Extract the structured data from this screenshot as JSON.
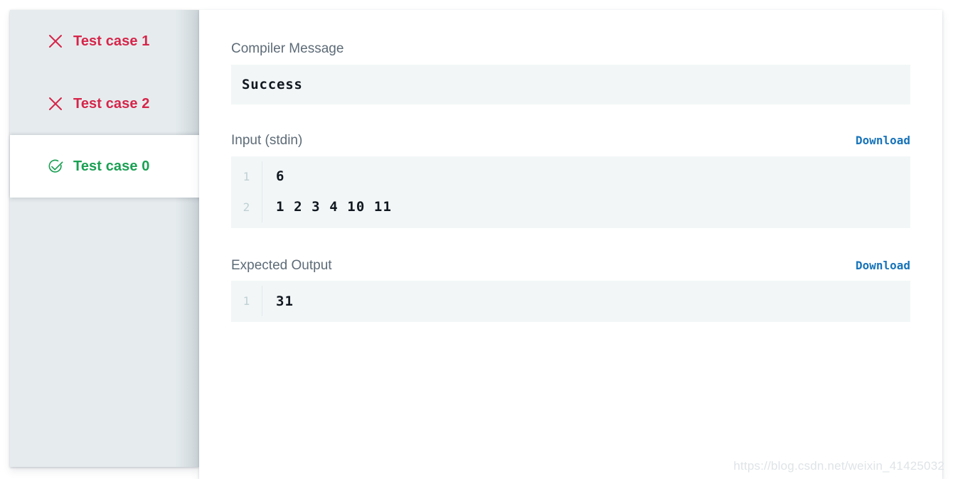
{
  "colors": {
    "fail": "#d6254a",
    "pass": "#1aa053",
    "link": "#1773b9",
    "label": "#5d6b77",
    "sidebar_bg": "#e6ecee",
    "code_bg": "#f2f6f7",
    "gutter_text": "#bfd0d3",
    "code_text": "#10171f"
  },
  "sidebar": {
    "items": [
      {
        "label": "Test case 1",
        "status": "failed",
        "icon": "close-x-icon",
        "active": false
      },
      {
        "label": "Test case 2",
        "status": "failed",
        "icon": "close-x-icon",
        "active": false
      },
      {
        "label": "Test case 0",
        "status": "passed",
        "icon": "check-circle-icon",
        "active": true
      }
    ]
  },
  "main": {
    "compiler": {
      "label": "Compiler Message",
      "message": "Success"
    },
    "input": {
      "label": "Input (stdin)",
      "download_label": "Download",
      "lines": [
        {
          "no": "1",
          "text": "6"
        },
        {
          "no": "2",
          "text": "1 2 3 4 10 11"
        }
      ]
    },
    "expected": {
      "label": "Expected Output",
      "download_label": "Download",
      "lines": [
        {
          "no": "1",
          "text": "31"
        }
      ]
    }
  },
  "watermark": "https://blog.csdn.net/weixin_41425032"
}
